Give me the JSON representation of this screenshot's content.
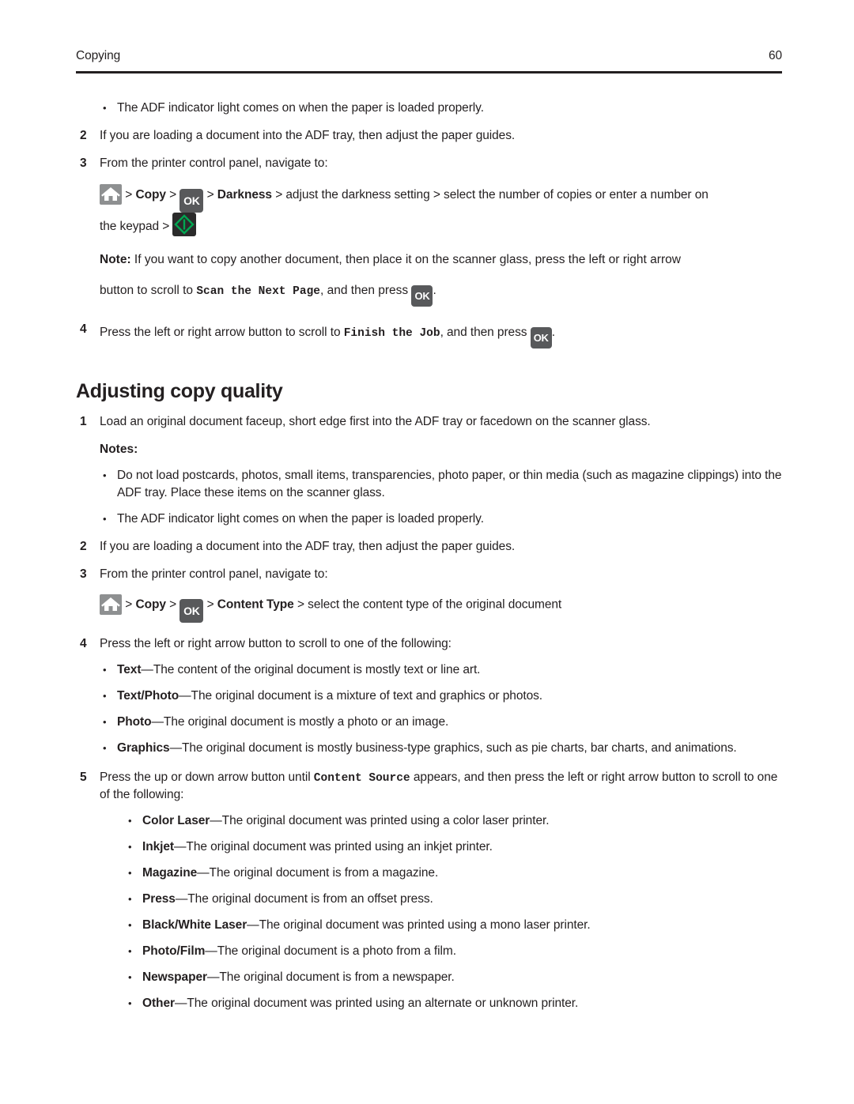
{
  "header": {
    "section": "Copying",
    "page_number": "60"
  },
  "icons": {
    "home": "home-icon",
    "ok": "OK",
    "start": "start-icon"
  },
  "colors": {
    "text": "#231f20",
    "home_button": "#8e9091",
    "ok_button": "#58595b",
    "start_button": "#2b2b2b",
    "start_green": "#00a651"
  },
  "top_section": {
    "bullet_adf": "The ADF indicator light comes on when the paper is loaded properly.",
    "step2_num": "2",
    "step2_text": "If you are loading a document into the ADF tray, then adjust the paper guides.",
    "step3_num": "3",
    "step3_text": "From the printer control panel, navigate to:",
    "nav": {
      "sep1": ">",
      "copy": "Copy",
      "sep2": ">",
      "sep3": ">",
      "darkness": "Darkness",
      "tail": "> adjust the darkness setting > select the number of copies or enter a number on",
      "keypad_label": "the keypad >"
    },
    "note": {
      "label": "Note:",
      "text_part1": "If you want to copy another document, then place it on the scanner glass, press the left or right arrow",
      "text_part2": "button to scroll to",
      "mono": "Scan the Next Page",
      "text_part3": ", and then press",
      "text_part4": "."
    },
    "step4_num": "4",
    "step4_text_part1": "Press the left or right arrow button to scroll to",
    "step4_mono": "Finish the Job",
    "step4_text_part2": ", and then press",
    "step4_text_part3": "."
  },
  "quality_section": {
    "heading": "Adjusting copy quality",
    "step1_num": "1",
    "step1_text": "Load an original document faceup, short edge first into the ADF tray or facedown on the scanner glass.",
    "notes_label": "Notes:",
    "notes": [
      "Do not load postcards, photos, small items, transparencies, photo paper, or thin media (such as magazine clippings) into the ADF tray. Place these items on the scanner glass.",
      "The ADF indicator light comes on when the paper is loaded properly."
    ],
    "step2_num": "2",
    "step2_text": "If you are loading a document into the ADF tray, then adjust the paper guides.",
    "step3_num": "3",
    "step3_text": "From the printer control panel, navigate to:",
    "nav": {
      "sep1": ">",
      "copy": "Copy",
      "sep2": ">",
      "sep3": ">",
      "content_type": "Content Type",
      "tail": "> select the content type of the original document"
    },
    "step4_num": "4",
    "step4_text": "Press the left or right arrow button to scroll to one of the following:",
    "content_types": [
      {
        "term": "Text",
        "desc": "—The content of the original document is mostly text or line art."
      },
      {
        "term": "Text/Photo",
        "desc": "—The original document is a mixture of text and graphics or photos."
      },
      {
        "term": "Photo",
        "desc": "—The original document is mostly a photo or an image."
      },
      {
        "term": "Graphics",
        "desc": "—The original document is mostly business-type graphics, such as pie charts, bar charts, and animations."
      }
    ],
    "step5_num": "5",
    "step5_text_part1": "Press the up or down arrow button until",
    "step5_mono": "Content Source",
    "step5_text_part2": "appears, and then press the left or right arrow button to scroll to one of the following:",
    "content_sources": [
      {
        "term": "Color Laser",
        "desc": "—The original document was printed using a color laser printer."
      },
      {
        "term": "Inkjet",
        "desc": "—The original document was printed using an inkjet printer."
      },
      {
        "term": "Magazine",
        "desc": "—The original document is from a magazine."
      },
      {
        "term": "Press",
        "desc": "—The original document is from an offset press."
      },
      {
        "term": "Black/White Laser",
        "desc": "—The original document was printed using a mono laser printer."
      },
      {
        "term": "Photo/Film",
        "desc": "—The original document is a photo from a film."
      },
      {
        "term": "Newspaper",
        "desc": "—The original document is from a newspaper."
      },
      {
        "term": "Other",
        "desc": "—The original document was printed using an alternate or unknown printer."
      }
    ]
  }
}
